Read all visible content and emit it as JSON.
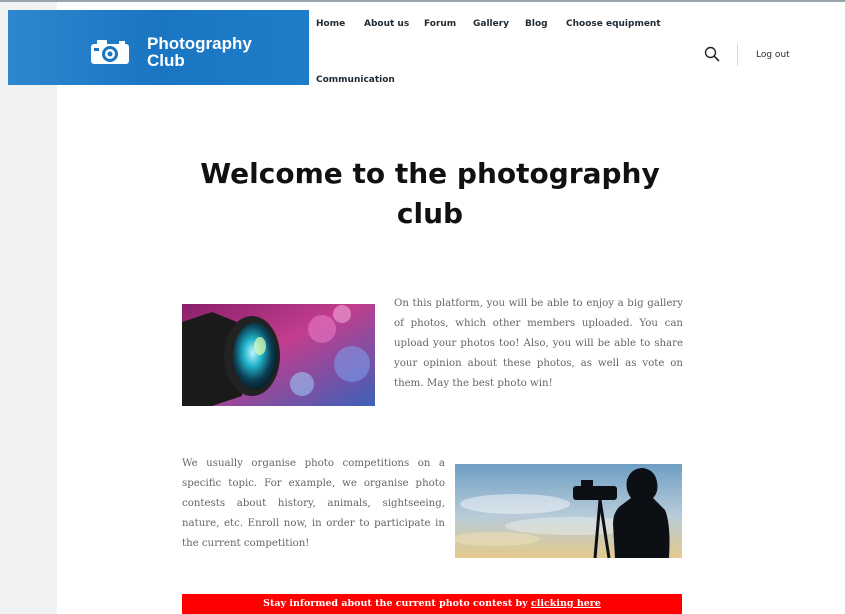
{
  "brand": {
    "title_line1": "Photography",
    "title_line2": "Club",
    "logo_icon": "camera-icon"
  },
  "nav": {
    "items": [
      "Home",
      "About us",
      "Forum",
      "Gallery",
      "Blog",
      "Choose equipment",
      "Communication"
    ]
  },
  "header": {
    "search_icon": "search-icon",
    "logout_label": "Log out"
  },
  "main": {
    "heading_line1": "Welcome to the photography",
    "heading_line2": "club",
    "paragraph1": "On this platform, you will be able to enjoy a big gallery of photos, which other members uploaded. You can upload your photos too!  Also, you will be able to share your opinion about these photos, as well as vote on them. May the best photo win!",
    "paragraph2": "We usually organise photo competitions on a specific topic. For example, we organise photo contests about history, animals, sightseeing, nature, etc. Enroll now, in order to participate in the current competition!",
    "banner_text": "Stay informed about the current photo contest by ",
    "banner_link": "clicking here"
  },
  "colors": {
    "brand_blue": "#1a76c2",
    "banner_red": "#fe0000",
    "left_strip": "#f1f2f4"
  }
}
